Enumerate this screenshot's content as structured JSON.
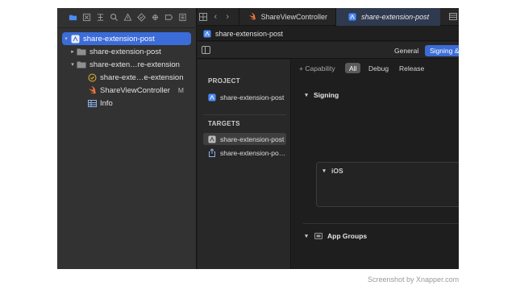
{
  "navigator": {
    "toolbar_icons": [
      "folder-icon",
      "source-control-icon",
      "symbol-icon",
      "search-icon",
      "issue-warning-icon",
      "test-diamond-icon",
      "debug-icon",
      "breakpoint-icon",
      "report-icon"
    ],
    "tree": [
      {
        "label": "share-extension-post",
        "icon": "project-icon",
        "expanded": true,
        "selected": true
      },
      {
        "label": "share-extension-post",
        "icon": "folder-icon",
        "expanded": false
      },
      {
        "label": "share-exten…re-extension",
        "icon": "folder-icon",
        "expanded": true
      },
      {
        "label": "share-exte…e-extension",
        "icon": "entitlements-icon"
      },
      {
        "label": "ShareViewController",
        "icon": "swift-icon",
        "status": "M"
      },
      {
        "label": "Info",
        "icon": "plist-icon"
      }
    ]
  },
  "editor": {
    "tabs": [
      {
        "label": "ShareViewController",
        "icon": "swift-icon",
        "active": false
      },
      {
        "label": "share-extension-post",
        "icon": "project-icon",
        "active": true
      }
    ],
    "jumpbar": "share-extension-post",
    "segments": [
      {
        "label": "General",
        "active": false
      },
      {
        "label": "Signing &",
        "active": true
      }
    ]
  },
  "targets_panel": {
    "project_header": "PROJECT",
    "project_item": "share-extension-post",
    "targets_header": "TARGETS",
    "targets": [
      {
        "label": "share-extension-post",
        "selected": true
      },
      {
        "label": "share-extension-po…",
        "selected": false
      }
    ]
  },
  "settings": {
    "capability_button": "+ Capability",
    "filters": [
      {
        "label": "All",
        "active": true
      },
      {
        "label": "Debug",
        "active": false
      },
      {
        "label": "Release",
        "active": false
      }
    ],
    "signing_header": "Signing",
    "ios_header": "iOS",
    "app_groups_header": "App Groups"
  },
  "watermark": "Screenshot by Xnapper.com",
  "colors": {
    "selection": "#3b6cd9",
    "background": "#1e1e1e",
    "sidebar": "#323232"
  }
}
